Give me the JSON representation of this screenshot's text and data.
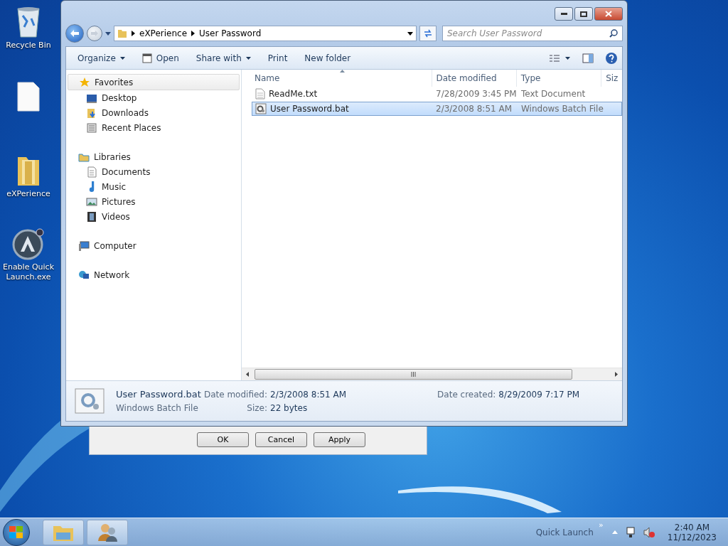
{
  "desktop_icons": [
    {
      "kind": "recycle",
      "label": "Recycle Bin"
    },
    {
      "kind": "file"
    },
    {
      "kind": "folder",
      "label": "eXPerience"
    },
    {
      "kind": "app",
      "label": "Enable Quick Launch.exe"
    }
  ],
  "back_dialog": {
    "buttons": [
      "OK",
      "Cancel",
      "Apply"
    ]
  },
  "window": {
    "address": [
      "eXPerience",
      "User Password"
    ],
    "search": {
      "placeholder": "Search User Password"
    },
    "toolbar": [
      {
        "label": "Organize",
        "kind": "menu"
      },
      {
        "label": "Open",
        "kind": "icon"
      },
      {
        "label": "Share with",
        "kind": "menu"
      },
      {
        "label": "Print",
        "kind": "plain"
      },
      {
        "label": "New folder",
        "kind": "plain"
      }
    ],
    "nav": [
      {
        "label": "Favorites",
        "kind": "star",
        "selected": true,
        "children": [
          {
            "label": "Desktop",
            "kind": "desktop"
          },
          {
            "label": "Downloads",
            "kind": "downloads"
          },
          {
            "label": "Recent Places",
            "kind": "recent"
          }
        ]
      },
      {
        "label": "Libraries",
        "kind": "libraries",
        "selected": false,
        "children": [
          {
            "label": "Documents",
            "kind": "documents"
          },
          {
            "label": "Music",
            "kind": "music"
          },
          {
            "label": "Pictures",
            "kind": "pictures"
          },
          {
            "label": "Videos",
            "kind": "videos"
          }
        ]
      },
      {
        "label": "Computer",
        "kind": "computer",
        "selected": false
      },
      {
        "label": "Network",
        "kind": "network",
        "selected": false
      }
    ],
    "columns": [
      "Name",
      "Date modified",
      "Type",
      "Siz"
    ],
    "rows": [
      {
        "kind": "text",
        "name": "ReadMe.txt",
        "date": "7/28/2009 3:45 PM",
        "type": "Text Document",
        "selected": false
      },
      {
        "kind": "batch",
        "name": "User Password.bat",
        "date": "2/3/2008 8:51 AM",
        "type": "Windows Batch File",
        "selected": true
      }
    ],
    "details": {
      "name": "User Password.bat",
      "type": "Windows Batch File",
      "fields": [
        {
          "label": "Date modified:",
          "value": "2/3/2008 8:51 AM"
        },
        {
          "label": "Date created:",
          "value": "8/29/2009 7:17 PM"
        },
        {
          "label": "Size:",
          "value": "22 bytes"
        }
      ]
    }
  },
  "taskbar": {
    "quick_launch": "Quick Launch",
    "chevron": "»",
    "time": "2:40 AM",
    "date": "11/12/2023"
  }
}
